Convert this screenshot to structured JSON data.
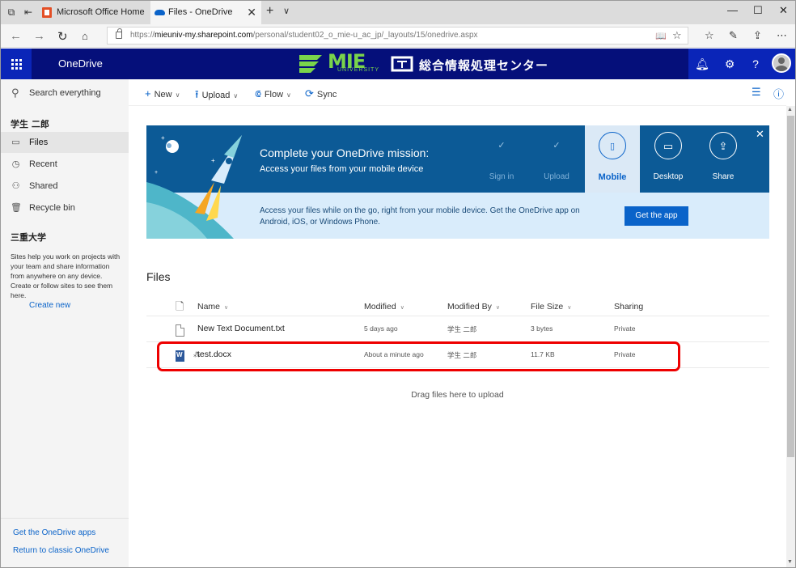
{
  "browser": {
    "tabs": [
      {
        "label": "Microsoft Office Home"
      },
      {
        "label": "Files - OneDrive"
      }
    ],
    "url_prefix": "https://",
    "url_host": "mieuniv-my.sharepoint.com",
    "url_path": "/personal/student02_o_mie-u_ac_jp/_layouts/15/onedrive.aspx"
  },
  "header": {
    "app_name": "OneDrive",
    "logo_text": "MIE",
    "logo_sub": "UNIVERSITY",
    "center_text": "総合情報処理センター"
  },
  "sidebar": {
    "search_label": "Search everything",
    "user_heading": "学生 二郎",
    "items": [
      {
        "label": "Files"
      },
      {
        "label": "Recent"
      },
      {
        "label": "Shared"
      },
      {
        "label": "Recycle bin"
      }
    ],
    "sites_heading": "三重大学",
    "sites_desc": "Sites help you work on projects with your team and share information from anywhere on any device. Create or follow sites to see them here.",
    "create_new": "Create new",
    "footer_links": [
      {
        "label": "Get the OneDrive apps"
      },
      {
        "label": "Return to classic OneDrive"
      }
    ]
  },
  "commands": {
    "new": "New",
    "upload": "Upload",
    "flow": "Flow",
    "sync": "Sync"
  },
  "banner": {
    "title": "Complete your OneDrive mission:",
    "subtitle": "Access your files from your mobile device",
    "steps": [
      {
        "label": "Sign in"
      },
      {
        "label": "Upload"
      },
      {
        "label": "Mobile"
      },
      {
        "label": "Desktop"
      },
      {
        "label": "Share"
      }
    ],
    "description": "Access your files while on the go, right from your mobile device. Get the OneDrive app on Android, iOS, or Windows Phone.",
    "button": "Get the app"
  },
  "files": {
    "title": "Files",
    "columns": {
      "name": "Name",
      "modified": "Modified",
      "modified_by": "Modified By",
      "file_size": "File Size",
      "sharing": "Sharing"
    },
    "rows": [
      {
        "name": "New Text Document.txt",
        "modified": "5 days ago",
        "modified_by": "学生 二郎",
        "size": "3 bytes",
        "sharing": "Private"
      },
      {
        "name": "test.docx",
        "modified": "About a minute ago",
        "modified_by": "学生 二郎",
        "size": "11.7 KB",
        "sharing": "Private"
      }
    ],
    "drag_hint": "Drag files here to upload"
  },
  "colors": {
    "suite_bar": "#050f7a",
    "accent": "#0a63c9",
    "banner_dark": "#0c5a96",
    "highlight": "#e00000"
  }
}
